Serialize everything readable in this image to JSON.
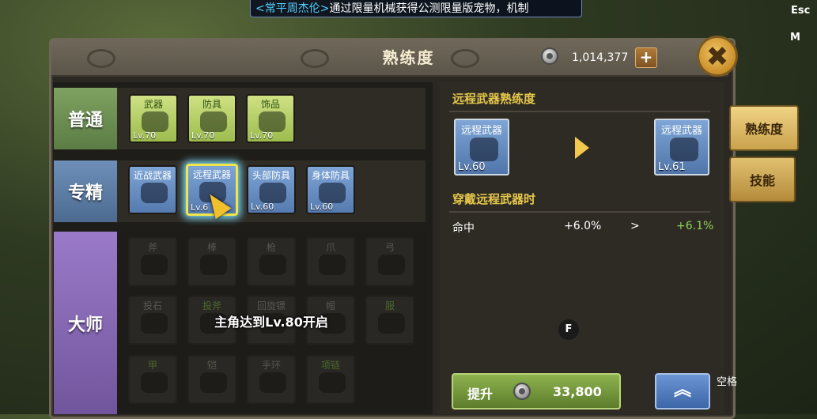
{
  "announcement": {
    "speaker": "<常平周杰伦>",
    "message": "通过限量机械获得公测限量版宠物，机制"
  },
  "hotkeys": {
    "esc": "Esc",
    "m": "M",
    "f": "F",
    "space": "空格"
  },
  "window": {
    "title": "熟练度"
  },
  "currency": {
    "amount": "1,014,377",
    "add_label": "+"
  },
  "close_label": "✖",
  "rows": {
    "normal": {
      "label": "普通",
      "items": [
        {
          "name": "武器",
          "level": "Lv.70"
        },
        {
          "name": "防具",
          "level": "Lv.70"
        },
        {
          "name": "饰品",
          "level": "Lv.70"
        }
      ]
    },
    "expert": {
      "label": "专精",
      "items": [
        {
          "name": "近战武器",
          "level": ""
        },
        {
          "name": "远程武器",
          "level": "Lv.6"
        },
        {
          "name": "头部防具",
          "level": "Lv.60"
        },
        {
          "name": "身体防具",
          "level": "Lv.60"
        }
      ]
    },
    "master": {
      "label": "大师",
      "locked_message": "主角达到Lv.80开启",
      "items": [
        {
          "name": "斧"
        },
        {
          "name": "棒"
        },
        {
          "name": "枪"
        },
        {
          "name": "爪"
        },
        {
          "name": "弓"
        },
        {
          "name": "投石"
        },
        {
          "name": "投斧"
        },
        {
          "name": "回旋镖"
        },
        {
          "name": "帽"
        },
        {
          "name": "服"
        },
        {
          "name": "甲"
        },
        {
          "name": "铠"
        },
        {
          "name": "手环"
        },
        {
          "name": "项链"
        }
      ]
    }
  },
  "detail": {
    "section_title": "远程武器熟练度",
    "current": {
      "name": "远程武器",
      "level": "Lv.60"
    },
    "next": {
      "name": "远程武器",
      "level": "Lv.61"
    },
    "effect_title": "穿戴远程武器时",
    "stats": [
      {
        "name": "命中",
        "current": "+6.0%",
        "arrow": ">",
        "next": "+6.1%"
      }
    ],
    "upgrade_label": "提升",
    "upgrade_cost": "33,800",
    "max_label": "︽"
  },
  "side_tabs": [
    {
      "label": "熟练度",
      "active": true
    },
    {
      "label": "技能",
      "active": false
    }
  ]
}
